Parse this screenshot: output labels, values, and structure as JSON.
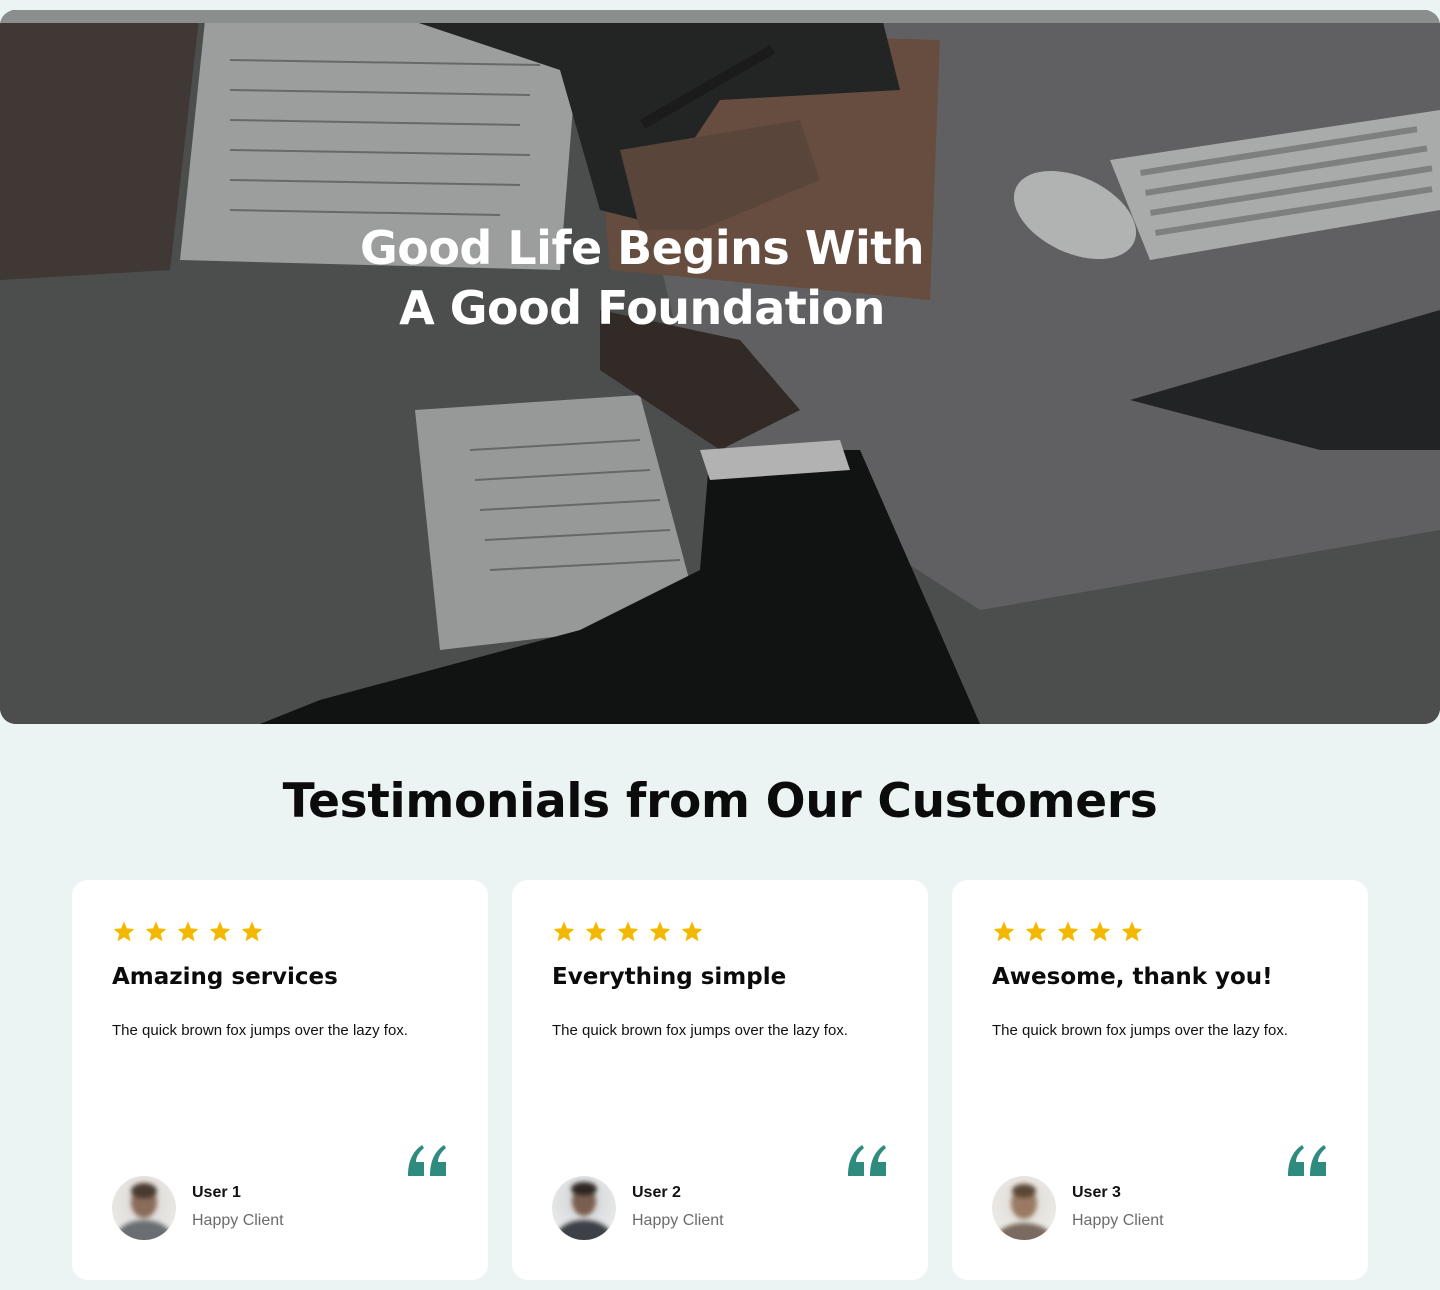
{
  "hero": {
    "title_line1": "Good Life Begins With",
    "title_line2": "A Good Foundation"
  },
  "testimonials": {
    "heading": "Testimonials from Our Customers",
    "star_color": "#f5b800",
    "quote_color": "#2e8b7e",
    "cards": [
      {
        "rating": 5,
        "title": "Amazing services",
        "body": "The quick brown fox jumps over the lazy fox.",
        "user_name": "User 1",
        "user_role": "Happy Client"
      },
      {
        "rating": 5,
        "title": "Everything simple",
        "body": "The quick brown fox jumps over the lazy fox.",
        "user_name": "User 2",
        "user_role": "Happy Client"
      },
      {
        "rating": 5,
        "title": "Awesome, thank you!",
        "body": "The quick brown fox jumps over the lazy fox.",
        "user_name": "User 3",
        "user_role": "Happy Client"
      }
    ]
  }
}
